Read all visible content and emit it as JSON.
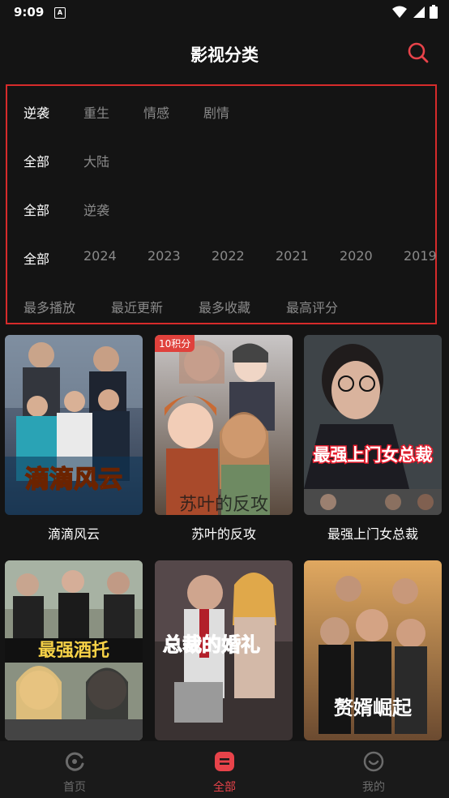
{
  "status_bar": {
    "time": "9:09",
    "notif_letter": "A"
  },
  "header": {
    "title": "影视分类"
  },
  "filters": {
    "genre": [
      "逆袭",
      "重生",
      "情感",
      "剧情"
    ],
    "region": [
      "全部",
      "大陆"
    ],
    "type": [
      "全部",
      "逆袭"
    ],
    "year": [
      "全部",
      "2024",
      "2023",
      "2022",
      "2021",
      "2020",
      "2019"
    ],
    "sort": [
      "最多播放",
      "最近更新",
      "最多收藏",
      "最高评分"
    ]
  },
  "cards": [
    {
      "title": "滴滴风云",
      "poster_text": "滴滴风云",
      "badge": ""
    },
    {
      "title": "苏叶的反攻",
      "poster_text": "苏叶的反攻",
      "badge": "10积分"
    },
    {
      "title": "最强上门女总裁",
      "poster_text": "最强上门女总裁",
      "badge": ""
    },
    {
      "title": "",
      "poster_text": "最强酒托",
      "badge": ""
    },
    {
      "title": "",
      "poster_text": "总裁的婚礼",
      "badge": ""
    },
    {
      "title": "",
      "poster_text": "赘婿崛起",
      "badge": ""
    }
  ],
  "tabs": {
    "home": "首页",
    "all": "全部",
    "mine": "我的"
  },
  "colors": {
    "accent": "#e8434a",
    "border": "#d62b2b",
    "bg": "#141414"
  }
}
